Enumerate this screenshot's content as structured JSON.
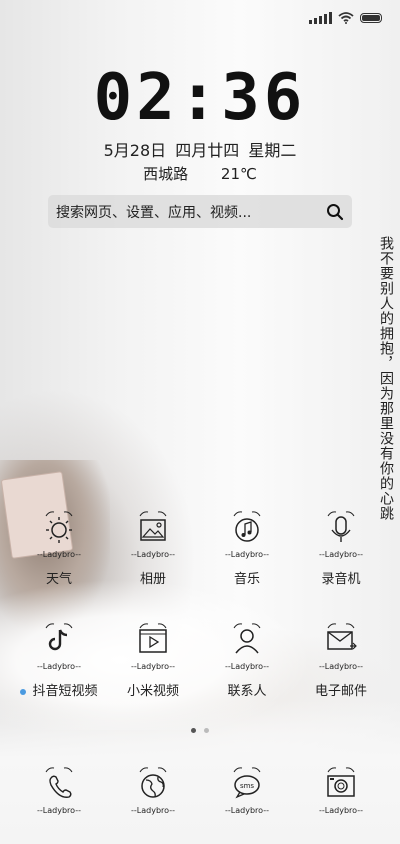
{
  "status": {
    "signal_icon": "signal-bars-icon",
    "wifi_icon": "wifi-icon",
    "battery_icon": "battery-icon",
    "battery_level": 1.0
  },
  "clock": {
    "time": "02:36"
  },
  "date": {
    "date": "5月28日",
    "lunar": "四月廿四",
    "weekday": "星期二"
  },
  "weather": {
    "location": "西城路",
    "temperature": "21℃"
  },
  "search": {
    "placeholder": "搜索网页、设置、应用、视频...",
    "icon": "search-icon"
  },
  "wallpaper": {
    "quote": "我不要别人的拥抱，因为那里没有你的心跳"
  },
  "apps_row1": [
    {
      "label": "天气",
      "brand": "Ladybro",
      "icon": "weather-sun-icon"
    },
    {
      "label": "相册",
      "brand": "Ladybro",
      "icon": "gallery-picture-icon"
    },
    {
      "label": "音乐",
      "brand": "Ladybro",
      "icon": "music-note-icon"
    },
    {
      "label": "录音机",
      "brand": "Ladybro",
      "icon": "microphone-icon"
    }
  ],
  "apps_row2": [
    {
      "label": "抖音短视频",
      "brand": "Ladybro",
      "icon": "tiktok-icon",
      "has_new": true
    },
    {
      "label": "小米视频",
      "brand": "Ladybro",
      "icon": "video-play-icon"
    },
    {
      "label": "联系人",
      "brand": "Ladybro",
      "icon": "contact-person-icon"
    },
    {
      "label": "电子邮件",
      "brand": "Ladybro",
      "icon": "mail-envelope-icon"
    }
  ],
  "pager": {
    "pages": 2,
    "current": 1,
    "active_color": "#555555",
    "inactive_color": "#bbbbbb"
  },
  "dock": [
    {
      "brand": "Ladybro",
      "icon": "phone-handset-icon"
    },
    {
      "brand": "Ladybro",
      "icon": "browser-globe-icon"
    },
    {
      "brand": "Ladybro",
      "icon": "sms-message-icon"
    },
    {
      "brand": "Ladybro",
      "icon": "camera-icon"
    }
  ]
}
